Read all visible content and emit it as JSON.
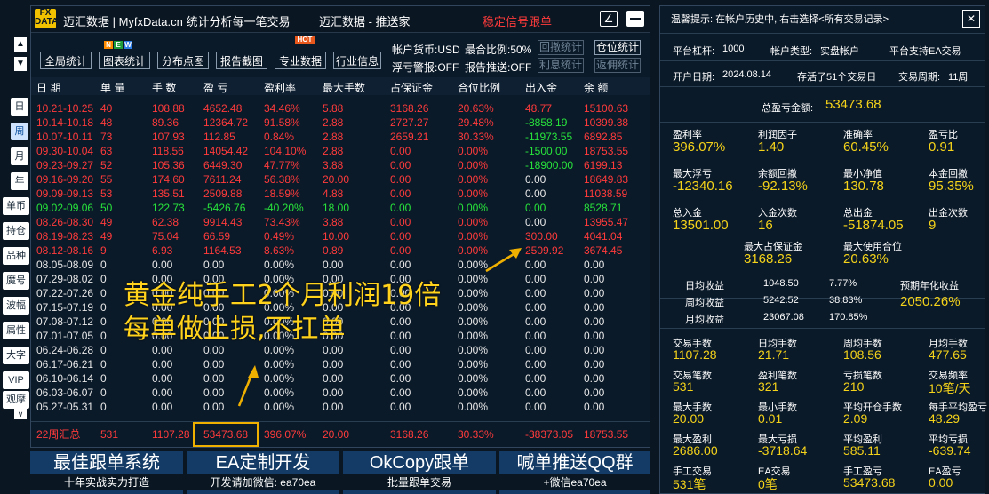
{
  "left": {
    "buttons": [
      "日",
      "周",
      "月",
      "年",
      "单币",
      "持仓",
      "品种",
      "魔号",
      "波幅",
      "属性",
      "大字",
      "VIP",
      "观摩"
    ]
  },
  "title": {
    "logo": "FX DATA",
    "app": "迈汇数据 | MyfxData.cn 统计分析每一笔交易",
    "center": "迈汇数据 - 推送家",
    "signal": "稳定信号跟单"
  },
  "toolbar": {
    "buttons": [
      "全局统计",
      "图表统计",
      "分布点图",
      "报告截图",
      "专业数据",
      "行业信息"
    ],
    "new_badge": [
      "N",
      "E",
      "W"
    ],
    "hot_badge": "HOT",
    "info": [
      "帐户货币:USD",
      "最合比例:50%",
      "浮亏警报:OFF",
      "报告推送:OFF"
    ],
    "right_buttons": [
      "回撤统计",
      "仓位统计",
      "利息统计",
      "返佣统计"
    ]
  },
  "table": {
    "headers": [
      "日 期",
      "单 量",
      "手 数",
      "盈 亏",
      "盈利率",
      "最大手数",
      "占保证金",
      "合位比例",
      "出入金",
      "余 额"
    ],
    "rows": [
      {
        "c": [
          "10.21-10.25",
          "40",
          "108.88",
          "4652.48",
          "34.46%",
          "5.88",
          "3168.26",
          "20.63%",
          "48.77",
          "15100.63"
        ],
        "k": "r"
      },
      {
        "c": [
          "10.14-10.18",
          "48",
          "89.36",
          "12364.72",
          "91.58%",
          "2.88",
          "2727.27",
          "29.48%",
          "-8858.19",
          "10399.38"
        ],
        "k": "r",
        "f": "g"
      },
      {
        "c": [
          "10.07-10.11",
          "73",
          "107.93",
          "112.85",
          "0.84%",
          "2.88",
          "2659.21",
          "30.33%",
          "-11973.55",
          "6892.85"
        ],
        "k": "r",
        "f": "g"
      },
      {
        "c": [
          "09.30-10.04",
          "63",
          "118.56",
          "14054.42",
          "104.10%",
          "2.88",
          "0.00",
          "0.00%",
          "-1500.00",
          "18753.55"
        ],
        "k": "r",
        "f": "g"
      },
      {
        "c": [
          "09.23-09.27",
          "52",
          "105.36",
          "6449.30",
          "47.77%",
          "3.88",
          "0.00",
          "0.00%",
          "-18900.00",
          "6199.13"
        ],
        "k": "r",
        "f": "g"
      },
      {
        "c": [
          "09.16-09.20",
          "55",
          "174.60",
          "7611.24",
          "56.38%",
          "20.00",
          "0.00",
          "0.00%",
          "0.00",
          "18649.83"
        ],
        "k": "r"
      },
      {
        "c": [
          "09.09-09.13",
          "53",
          "135.51",
          "2509.88",
          "18.59%",
          "4.88",
          "0.00",
          "0.00%",
          "0.00",
          "11038.59"
        ],
        "k": "r"
      },
      {
        "c": [
          "09.02-09.06",
          "50",
          "122.73",
          "-5426.76",
          "-40.20%",
          "18.00",
          "0.00",
          "0.00%",
          "0.00",
          "8528.71"
        ],
        "k": "g"
      },
      {
        "c": [
          "08.26-08.30",
          "49",
          "62.38",
          "9914.43",
          "73.43%",
          "3.88",
          "0.00",
          "0.00%",
          "0.00",
          "13955.47"
        ],
        "k": "r"
      },
      {
        "c": [
          "08.19-08.23",
          "49",
          "75.04",
          "66.59",
          "0.49%",
          "10.00",
          "0.00",
          "0.00%",
          "300.00",
          "4041.04"
        ],
        "k": "r"
      },
      {
        "c": [
          "08.12-08.16",
          "9",
          "6.93",
          "1164.53",
          "8.63%",
          "0.89",
          "0.00",
          "0.00%",
          "2509.92",
          "3674.45"
        ],
        "k": "r"
      },
      {
        "c": [
          "08.05-08.09",
          "0",
          "0.00",
          "0.00",
          "0.00%",
          "0.00",
          "0.00",
          "0.00%",
          "0.00",
          "0.00"
        ],
        "k": "w"
      },
      {
        "c": [
          "07.29-08.02",
          "0",
          "0.00",
          "0.00",
          "0.00%",
          "0.00",
          "0.00",
          "0.00%",
          "0.00",
          "0.00"
        ],
        "k": "w"
      },
      {
        "c": [
          "07.22-07.26",
          "0",
          "0.00",
          "0.00",
          "0.00%",
          "0.00",
          "0.00",
          "0.00%",
          "0.00",
          "0.00"
        ],
        "k": "w"
      },
      {
        "c": [
          "07.15-07.19",
          "0",
          "0.00",
          "0.00",
          "0.00%",
          "0.00",
          "0.00",
          "0.00%",
          "0.00",
          "0.00"
        ],
        "k": "w"
      },
      {
        "c": [
          "07.08-07.12",
          "0",
          "0.00",
          "0.00",
          "0.00%",
          "0.00",
          "0.00",
          "0.00%",
          "0.00",
          "0.00"
        ],
        "k": "w"
      },
      {
        "c": [
          "07.01-07.05",
          "0",
          "0.00",
          "0.00",
          "0.00%",
          "0.00",
          "0.00",
          "0.00%",
          "0.00",
          "0.00"
        ],
        "k": "w"
      },
      {
        "c": [
          "06.24-06.28",
          "0",
          "0.00",
          "0.00",
          "0.00%",
          "0.00",
          "0.00",
          "0.00%",
          "0.00",
          "0.00"
        ],
        "k": "w"
      },
      {
        "c": [
          "06.17-06.21",
          "0",
          "0.00",
          "0.00",
          "0.00%",
          "0.00",
          "0.00",
          "0.00%",
          "0.00",
          "0.00"
        ],
        "k": "w"
      },
      {
        "c": [
          "06.10-06.14",
          "0",
          "0.00",
          "0.00",
          "0.00%",
          "0.00",
          "0.00",
          "0.00%",
          "0.00",
          "0.00"
        ],
        "k": "w"
      },
      {
        "c": [
          "06.03-06.07",
          "0",
          "0.00",
          "0.00",
          "0.00%",
          "0.00",
          "0.00",
          "0.00%",
          "0.00",
          "0.00"
        ],
        "k": "w"
      },
      {
        "c": [
          "05.27-05.31",
          "0",
          "0.00",
          "0.00",
          "0.00%",
          "0.00",
          "0.00",
          "0.00%",
          "0.00",
          "0.00"
        ],
        "k": "w"
      }
    ],
    "summary": [
      "22周汇总",
      "531",
      "1107.28",
      "53473.68",
      "396.07%",
      "20.00",
      "3168.26",
      "30.33%",
      "-38373.05",
      "18753.55"
    ]
  },
  "overlay": {
    "line1": "黄金纯手工2个月利润19倍",
    "line2": "每单做止损,不扛单"
  },
  "ads": [
    {
      "big": "最佳跟单系统",
      "small": "十年实战实力打造"
    },
    {
      "big": "EA定制开发",
      "small": "开发请加微信: ea70ea"
    },
    {
      "big": "OkCopy跟单",
      "small": "批量跟单交易"
    },
    {
      "big": "喊单推送QQ群",
      "small": "+微信ea70ea"
    }
  ],
  "right": {
    "tip": "温馨提示: 在帐户历史中, 右击选择<所有交易记录>",
    "r1": [
      "平台杠杆:",
      "1000",
      "帐户类型:",
      "实盘帐户",
      "平台支持EA交易"
    ],
    "r2": [
      "开户日期:",
      "2024.08.14",
      "存活了51个交易日",
      "交易周期:",
      "11周"
    ],
    "total_label": "总盈亏金额:",
    "total_value": "53473.68",
    "grid": [
      [
        [
          "盈利率",
          "396.07%"
        ],
        [
          "利润因子",
          "1.40"
        ],
        [
          "准确率",
          "60.45%"
        ],
        [
          "盈亏比",
          "0.91"
        ]
      ],
      [
        [
          "最大浮亏",
          "-12340.16"
        ],
        [
          "余额回撤",
          "-92.13%"
        ],
        [
          "最小净值",
          "130.78"
        ],
        [
          "本金回撤",
          "95.35%"
        ]
      ],
      [
        [
          "总入金",
          "13501.00"
        ],
        [
          "入金次数",
          "16"
        ],
        [
          "总出金",
          "-51874.05"
        ],
        [
          "出金次数",
          "9"
        ]
      ]
    ],
    "margin": [
      [
        "最大占保证金",
        "3168.26"
      ],
      [
        "最大使用合位",
        "20.63%"
      ]
    ],
    "avg": [
      [
        "日均收益",
        "1048.50",
        "7.77%"
      ],
      [
        "周均收益",
        "5242.52",
        "38.83%"
      ],
      [
        "月均收益",
        "23067.08",
        "170.85%"
      ]
    ],
    "annual_label": "预期年化收益",
    "annual_value": "2050.26%",
    "grid2": [
      [
        [
          "交易手数",
          "1107.28"
        ],
        [
          "日均手数",
          "21.71"
        ],
        [
          "周均手数",
          "108.56"
        ],
        [
          "月均手数",
          "477.65"
        ]
      ],
      [
        [
          "交易笔数",
          "531"
        ],
        [
          "盈利笔数",
          "321"
        ],
        [
          "亏损笔数",
          "210"
        ],
        [
          "交易频率",
          "10笔/天"
        ]
      ],
      [
        [
          "最大手数",
          "20.00"
        ],
        [
          "最小手数",
          "0.01"
        ],
        [
          "平均开仓手数",
          "2.09"
        ],
        [
          "每手平均盈亏",
          "48.29"
        ]
      ],
      [
        [
          "最大盈利",
          "2686.00"
        ],
        [
          "最大亏损",
          "-3718.64"
        ],
        [
          "平均盈利",
          "585.11"
        ],
        [
          "平均亏损",
          "-639.74"
        ]
      ],
      [
        [
          "手工交易",
          "531笔"
        ],
        [
          "EA交易",
          "0笔"
        ],
        [
          "手工盈亏",
          "53473.68"
        ],
        [
          "EA盈亏",
          "0.00"
        ]
      ]
    ]
  }
}
